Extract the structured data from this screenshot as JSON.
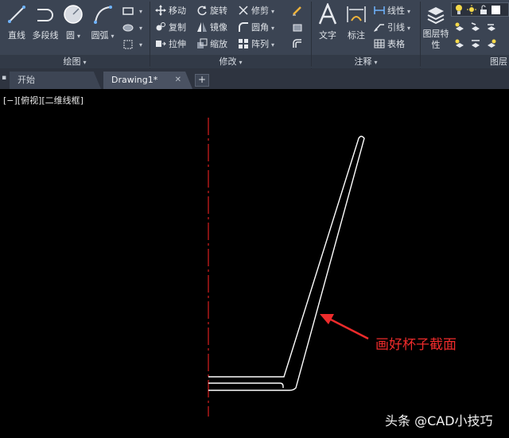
{
  "ribbon": {
    "draw_panel": {
      "title": "绘图",
      "line": "直线",
      "polyline": "多段线",
      "circle": "圆",
      "arc": "圆弧"
    },
    "modify_panel": {
      "title": "修改",
      "move": "移动",
      "rotate": "旋转",
      "trim": "修剪",
      "copy": "复制",
      "mirror": "镜像",
      "fillet": "圆角",
      "stretch": "拉伸",
      "scale": "缩放",
      "array": "阵列"
    },
    "annotation_panel": {
      "title": "注释",
      "text": "文字",
      "dimension": "标注",
      "linear": "线性",
      "leader": "引线",
      "table": "表格"
    },
    "layers_panel": {
      "title": "图层",
      "layer_properties": "图层特性"
    }
  },
  "tabs": [
    {
      "label": "开始"
    },
    {
      "label": "Drawing1*"
    }
  ],
  "viewport_label": "[−][俯视][二维线框]",
  "annotation_text": "画好杯子截面",
  "watermark": "头条 @CAD小技巧",
  "colors": {
    "ribbon_bg": "#3b4453",
    "canvas_bg": "#000000",
    "centerline": "#d81e1e",
    "profile": "#ffffff",
    "annotation": "#ee2b2b"
  }
}
